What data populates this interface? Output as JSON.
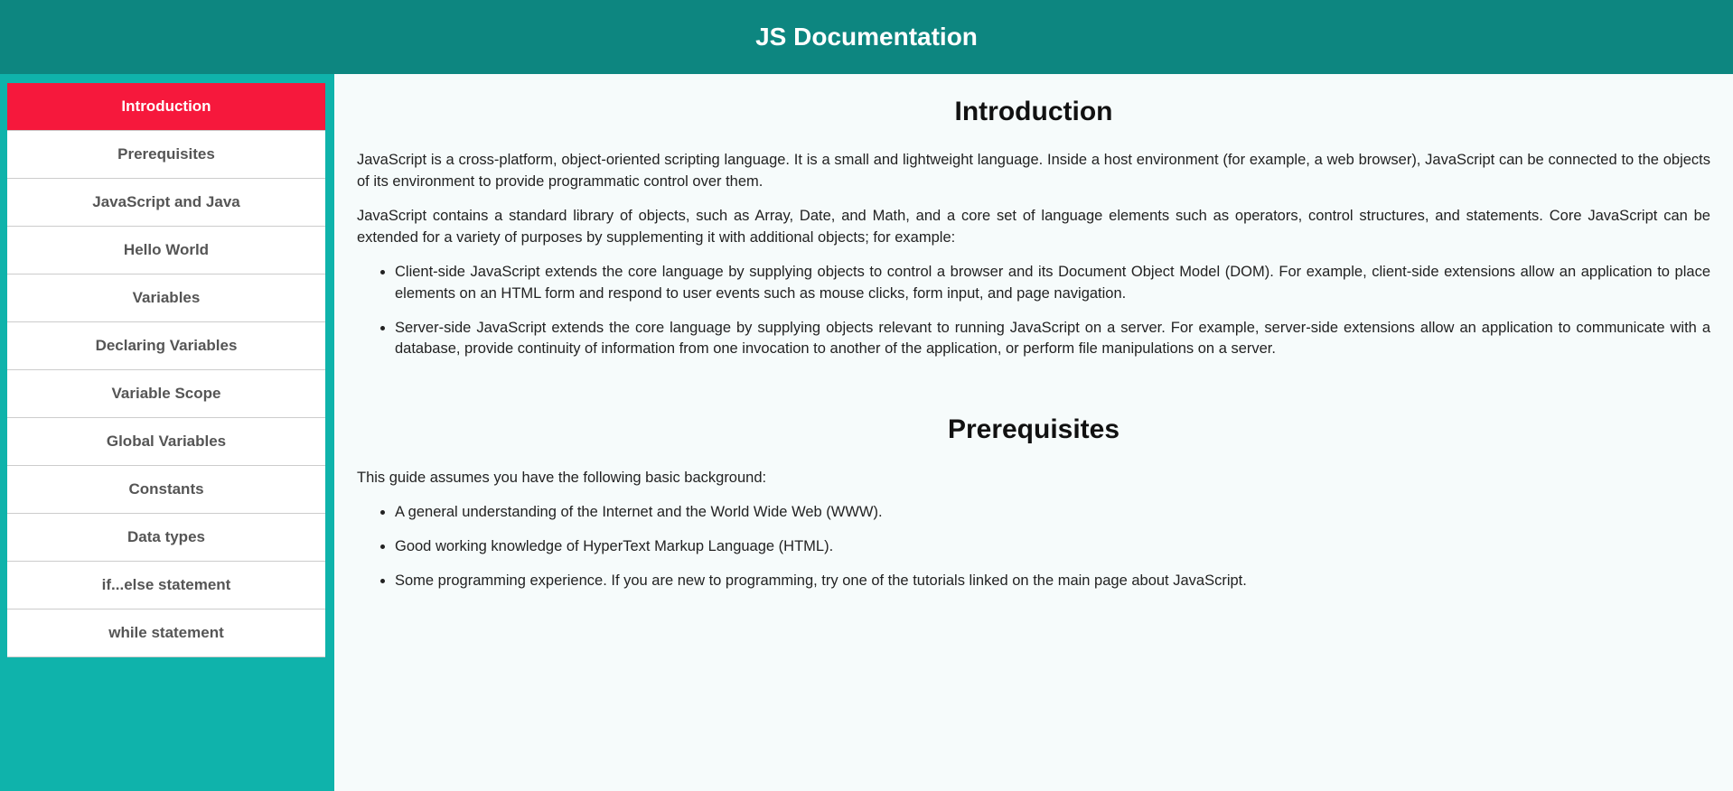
{
  "header": {
    "title": "JS Documentation"
  },
  "nav": {
    "items": [
      {
        "label": "Introduction",
        "active": true
      },
      {
        "label": "Prerequisites",
        "active": false
      },
      {
        "label": "JavaScript and Java",
        "active": false
      },
      {
        "label": "Hello World",
        "active": false
      },
      {
        "label": "Variables",
        "active": false
      },
      {
        "label": "Declaring Variables",
        "active": false
      },
      {
        "label": "Variable Scope",
        "active": false
      },
      {
        "label": "Global Variables",
        "active": false
      },
      {
        "label": "Constants",
        "active": false
      },
      {
        "label": "Data types",
        "active": false
      },
      {
        "label": "if...else statement",
        "active": false
      },
      {
        "label": "while statement",
        "active": false
      }
    ]
  },
  "sections": {
    "introduction": {
      "heading": "Introduction",
      "p1": "JavaScript is a cross-platform, object-oriented scripting language. It is a small and lightweight language. Inside a host environment (for example, a web browser), JavaScript can be connected to the objects of its environment to provide programmatic control over them.",
      "p2": "JavaScript contains a standard library of objects, such as Array, Date, and Math, and a core set of language elements such as operators, control structures, and statements. Core JavaScript can be extended for a variety of purposes by supplementing it with additional objects; for example:",
      "li1": "Client-side JavaScript extends the core language by supplying objects to control a browser and its Document Object Model (DOM). For example, client-side extensions allow an application to place elements on an HTML form and respond to user events such as mouse clicks, form input, and page navigation.",
      "li2": "Server-side JavaScript extends the core language by supplying objects relevant to running JavaScript on a server. For example, server-side extensions allow an application to communicate with a database, provide continuity of information from one invocation to another of the application, or perform file manipulations on a server."
    },
    "prerequisites": {
      "heading": "Prerequisites",
      "p1": "This guide assumes you have the following basic background:",
      "li1": "A general understanding of the Internet and the World Wide Web (WWW).",
      "li2": "Good working knowledge of HyperText Markup Language (HTML).",
      "li3": "Some programming experience. If you are new to programming, try one of the tutorials linked on the main page about JavaScript."
    }
  }
}
